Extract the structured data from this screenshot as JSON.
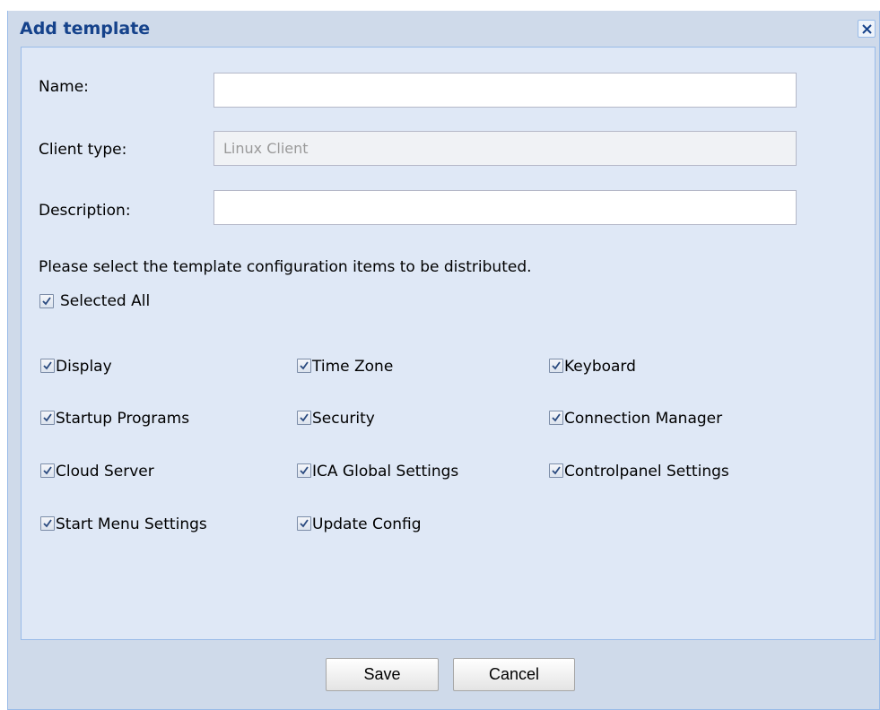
{
  "dialog": {
    "title": "Add template",
    "close_icon": "close-x-icon"
  },
  "form": {
    "name_label": "Name:",
    "name_value": "",
    "client_type_label": "Client type:",
    "client_type_value": "Linux Client",
    "description_label": "Description:",
    "description_value": ""
  },
  "instructions": "Please select the template configuration items to be distributed.",
  "select_all": {
    "label": "Selected All",
    "checked": true
  },
  "items": [
    {
      "label": "Display",
      "checked": true
    },
    {
      "label": "Time Zone",
      "checked": true
    },
    {
      "label": "Keyboard",
      "checked": true
    },
    {
      "label": "Startup Programs",
      "checked": true
    },
    {
      "label": "Security",
      "checked": true
    },
    {
      "label": "Connection Manager",
      "checked": true
    },
    {
      "label": "Cloud Server",
      "checked": true
    },
    {
      "label": "ICA Global Settings",
      "checked": true
    },
    {
      "label": "Controlpanel Settings",
      "checked": true
    },
    {
      "label": "Start Menu Settings",
      "checked": true
    },
    {
      "label": "Update Config",
      "checked": true
    }
  ],
  "buttons": {
    "save": "Save",
    "cancel": "Cancel"
  },
  "colors": {
    "title": "#15428b",
    "dialog_bg": "#cfdaea",
    "panel_bg": "#dfe8f6",
    "border": "#99bbe8"
  }
}
